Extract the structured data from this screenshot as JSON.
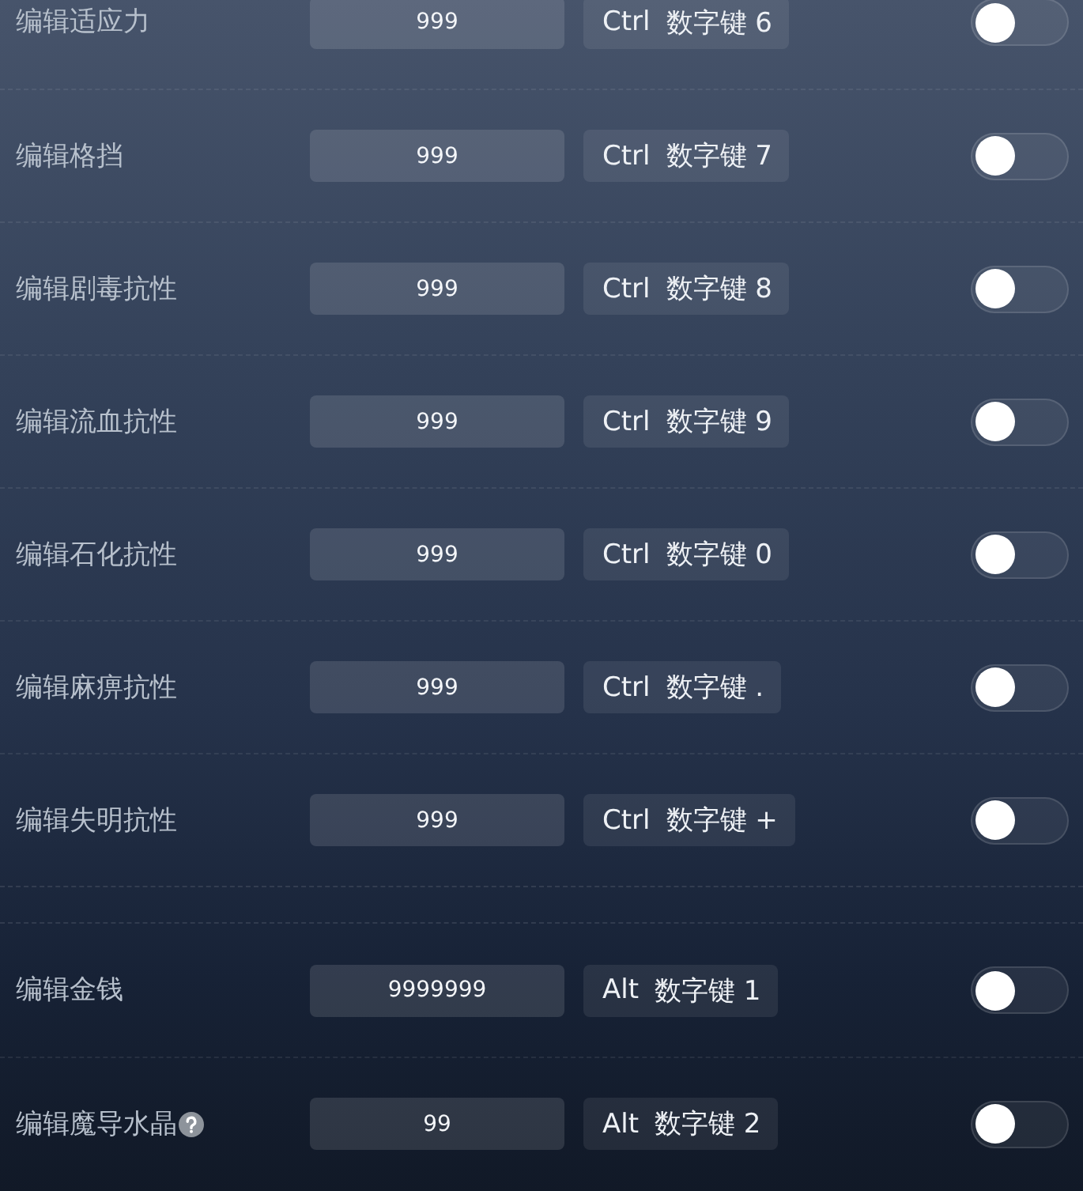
{
  "sections": [
    {
      "rows": [
        {
          "label": "编辑适应力",
          "value": "999",
          "hotkey": {
            "modifier": "Ctrl",
            "key": "数字键 6"
          },
          "on": false
        },
        {
          "label": "编辑格挡",
          "value": "999",
          "hotkey": {
            "modifier": "Ctrl",
            "key": "数字键 7"
          },
          "on": false
        },
        {
          "label": "编辑剧毒抗性",
          "value": "999",
          "hotkey": {
            "modifier": "Ctrl",
            "key": "数字键 8"
          },
          "on": false
        },
        {
          "label": "编辑流血抗性",
          "value": "999",
          "hotkey": {
            "modifier": "Ctrl",
            "key": "数字键 9"
          },
          "on": false
        },
        {
          "label": "编辑石化抗性",
          "value": "999",
          "hotkey": {
            "modifier": "Ctrl",
            "key": "数字键 0"
          },
          "on": false
        },
        {
          "label": "编辑麻痹抗性",
          "value": "999",
          "hotkey": {
            "modifier": "Ctrl",
            "key": "数字键 ."
          },
          "on": false
        },
        {
          "label": "编辑失明抗性",
          "value": "999",
          "hotkey": {
            "modifier": "Ctrl",
            "key": "数字键 +"
          },
          "on": false
        }
      ]
    },
    {
      "rows": [
        {
          "label": "编辑金钱",
          "value": "9999999",
          "hotkey": {
            "modifier": "Alt",
            "key": "数字键 1"
          },
          "on": false
        },
        {
          "label": "编辑魔导水晶",
          "value": "99",
          "hotkey": {
            "modifier": "Alt",
            "key": "数字键 2"
          },
          "help_icon": true,
          "on": false
        }
      ]
    }
  ]
}
